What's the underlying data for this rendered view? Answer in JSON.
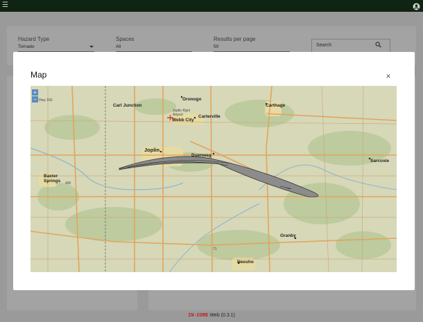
{
  "topbar": {
    "menu_icon": "hamburger-menu-icon",
    "account_icon": "account-circle-icon"
  },
  "filters": {
    "hazard_type": {
      "label": "Hazard Type",
      "value": "Tornado"
    },
    "spaces": {
      "label": "Spaces",
      "value": "All"
    },
    "results_per_page": {
      "label": "Results per page",
      "value": "50"
    },
    "search": {
      "placeholder": "Search"
    }
  },
  "modal": {
    "title": "Map",
    "close_label": "×"
  },
  "map": {
    "zoom_in": "+",
    "zoom_out": "−",
    "places": {
      "carl_junction": "Carl Junction",
      "oronogo": "Oronogo",
      "carthage": "Carthage",
      "joplin_airport": "Joplin Rgnl Airport",
      "webb_city": "Webb City",
      "carterville": "Carterville",
      "joplin": "Joplin",
      "duenweg": "Duenweg",
      "sarcoxie": "Sarcoxie",
      "baxter_springs": "Baxter Springs",
      "granby": "Granby",
      "neosho": "Neosho"
    },
    "road_labels": {
      "hwy_160": "Hwy 160",
      "hwy_400": "400",
      "hwy_71": "71"
    }
  },
  "footer": {
    "brand": "IN-CORE",
    "text": " Web (0.3.1)"
  },
  "colors": {
    "topbar": "#0f2412",
    "overlay": "#9a9a9a",
    "modal_bg": "#ffffff",
    "map_land": "#d6d8b8",
    "road_major": "#e2a45b",
    "tornado_path": "#8c8c8c",
    "footer_brand": "#b22222"
  }
}
